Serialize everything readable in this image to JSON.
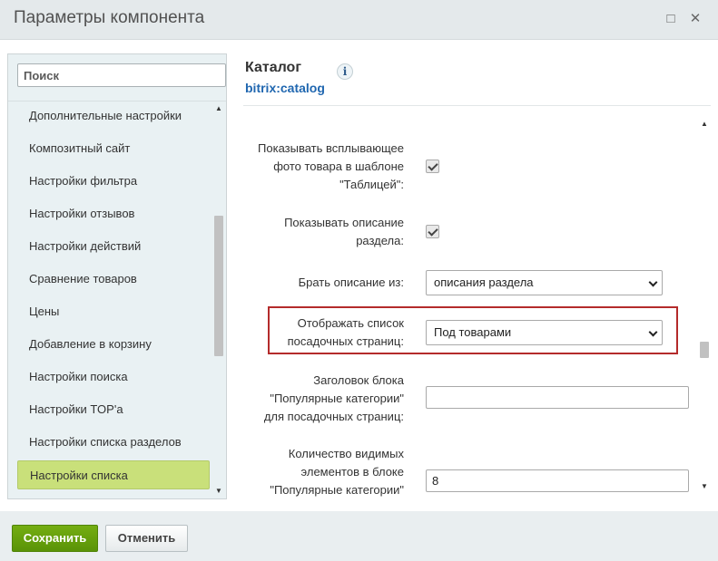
{
  "window": {
    "title": "Параметры компонента",
    "maximize_glyph": "□",
    "close_glyph": "✕"
  },
  "sidebar": {
    "search_placeholder": "Поиск",
    "items": [
      {
        "label": "Дополнительные настройки"
      },
      {
        "label": "Композитный сайт"
      },
      {
        "label": "Настройки фильтра"
      },
      {
        "label": "Настройки отзывов"
      },
      {
        "label": "Настройки действий"
      },
      {
        "label": "Сравнение товаров"
      },
      {
        "label": "Цены"
      },
      {
        "label": "Добавление в корзину"
      },
      {
        "label": "Настройки поиска"
      },
      {
        "label": "Настройки TOP'а"
      },
      {
        "label": "Настройки списка разделов"
      },
      {
        "label": "Настройки списка",
        "active": true
      }
    ]
  },
  "component": {
    "title": "Каталог",
    "code": "bitrix:catalog",
    "info_glyph": "i"
  },
  "settings": {
    "row1": {
      "label_lines": [
        "Показывать всплывающее",
        "фото товара в шаблоне",
        "\"Таблицей\":"
      ],
      "checked": true
    },
    "row2": {
      "label_lines": [
        "Показывать описание",
        "раздела:"
      ],
      "checked": true
    },
    "row3": {
      "label": "Брать описание из:",
      "value": "описания раздела"
    },
    "row4": {
      "label_lines": [
        "Отображать список",
        "посадочных страниц:"
      ],
      "value": "Под товарами"
    },
    "row5": {
      "label_lines": [
        "Заголовок блока",
        "\"Популярные категории\"",
        "для посадочных страниц:"
      ],
      "value": ""
    },
    "row6": {
      "label_lines": [
        "Количество видимых",
        "элементов в блоке",
        "\"Популярные категории\""
      ],
      "value": "8"
    }
  },
  "footer": {
    "save_label": "Сохранить",
    "cancel_label": "Отменить"
  },
  "colors": {
    "save_button": "#5a9307",
    "active_item": "#c9e07a",
    "highlight_border": "#b42b2b",
    "component_code": "#2067b0"
  }
}
